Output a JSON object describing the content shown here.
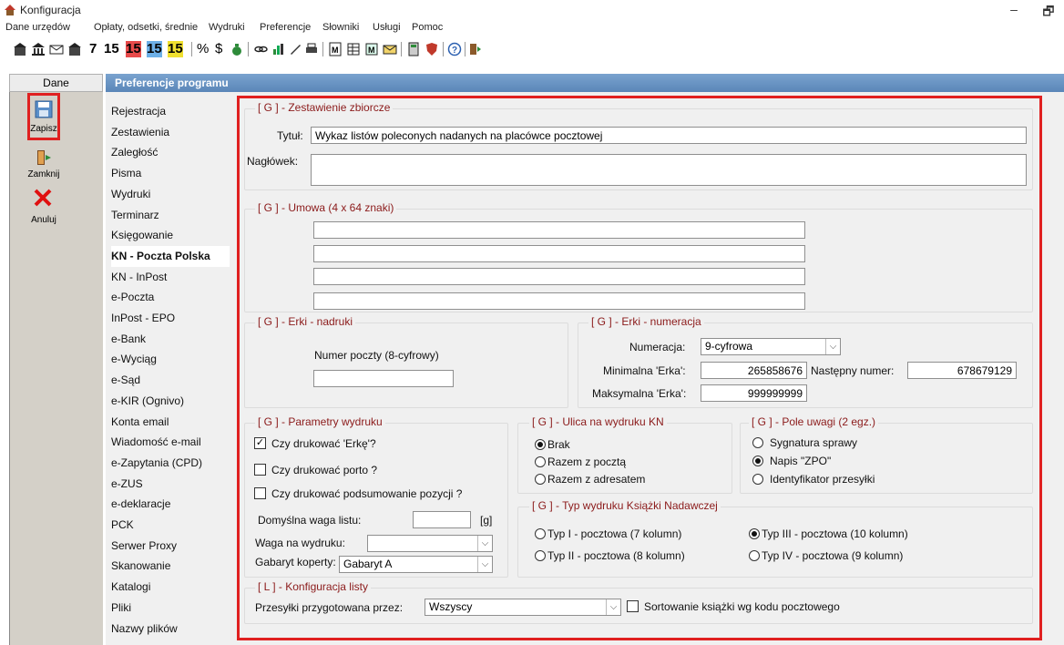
{
  "window": {
    "title": "Konfiguracja",
    "minimize": "–",
    "restore": "🗗"
  },
  "menu": [
    "Dane urzędów",
    "Opłaty, odsetki, średnie",
    "Wydruki",
    "Preferencje",
    "Słowniki",
    "Usługi",
    "Pomoc"
  ],
  "toolbar": {
    "nums": [
      "7",
      "15",
      "15",
      "15",
      "15"
    ],
    "percent": "%",
    "dollar": "$"
  },
  "sidepanel": {
    "tab": "Dane",
    "save": "Zapisz",
    "close": "Zamknij",
    "cancel": "Anuluj"
  },
  "header": "Preferencje programu",
  "nav": [
    "Rejestracja",
    "Zestawienia",
    "Zaległość",
    "Pisma",
    "Wydruki",
    "Terminarz",
    "Księgowanie",
    "KN - Poczta Polska",
    "KN - InPost",
    "e-Poczta",
    "InPost - EPO",
    "e-Bank",
    "e-Wyciąg",
    "e-Sąd",
    "e-KIR (Ognivo)",
    "Konta email",
    "Wiadomość e-mail",
    "e-Zapytania (CPD)",
    "e-ZUS",
    "e-deklaracje",
    "PCK",
    "Serwer Proxy",
    "Skanowanie",
    "Katalogi",
    "Pliki",
    "Nazwy plików"
  ],
  "zestawienie": {
    "title": "[ G ] - Zestawienie zbiorcze",
    "tytul_label": "Tytuł:",
    "tytul_value": "Wykaz listów poleconych nadanych na placówce pocztowej",
    "naglowek_label": "Nagłówek:"
  },
  "umowa": {
    "title": "[ G ] - Umowa  (4 x 64 znaki)"
  },
  "erki_nadruki": {
    "title": "[ G ] - Erki - nadruki",
    "numer_label": "Numer poczty (8-cyfrowy)"
  },
  "erki_numeracja": {
    "title": "[ G ] - Erki - numeracja",
    "numeracja_label": "Numeracja:",
    "numeracja_value": "9-cyfrowa",
    "min_label": "Minimalna 'Erka':",
    "min_value": "265858676",
    "next_label": "Następny numer:",
    "next_value": "678679129",
    "max_label": "Maksymalna 'Erka':",
    "max_value": "999999999"
  },
  "parametry": {
    "title": "[ G ] - Parametry wydruku",
    "chk1": "Czy drukować 'Erkę'?",
    "chk2": "Czy drukować porto ?",
    "chk3": "Czy drukować podsumowanie pozycji ?",
    "waga_label": "Domyślna waga listu:",
    "waga_unit": "[g]",
    "waga_wydruk_label": "Waga na wydruku:",
    "gabaryt_label": "Gabaryt koperty:",
    "gabaryt_value": "Gabaryt A"
  },
  "ulica": {
    "title": "[ G ] -  Ulica na wydruku KN",
    "r1": "Brak",
    "r2": "Razem z pocztą",
    "r3": "Razem z adresatem"
  },
  "uwagi": {
    "title": "[ G ] - Pole uwagi (2 egz.)",
    "r1": "Sygnatura sprawy",
    "r2": "Napis \"ZPO\"",
    "r3": "Identyfikator przesyłki"
  },
  "typ": {
    "title": "[ G ] - Typ wydruku Książki Nadawczej",
    "r1": "Typ I  - pocztowa  (7 kolumn)",
    "r2": "Typ II - pocztowa  (8 kolumn)",
    "r3": "Typ III - pocztowa (10 kolumn)",
    "r4": "Typ IV - pocztowa  (9 kolumn)"
  },
  "lista": {
    "title": "[ L ] - Konfiguracja listy",
    "przesylki_label": "Przesyłki przygotowana przez:",
    "przesylki_value": "Wszyscy",
    "sort_label": "Sortowanie książki wg kodu pocztowego"
  }
}
